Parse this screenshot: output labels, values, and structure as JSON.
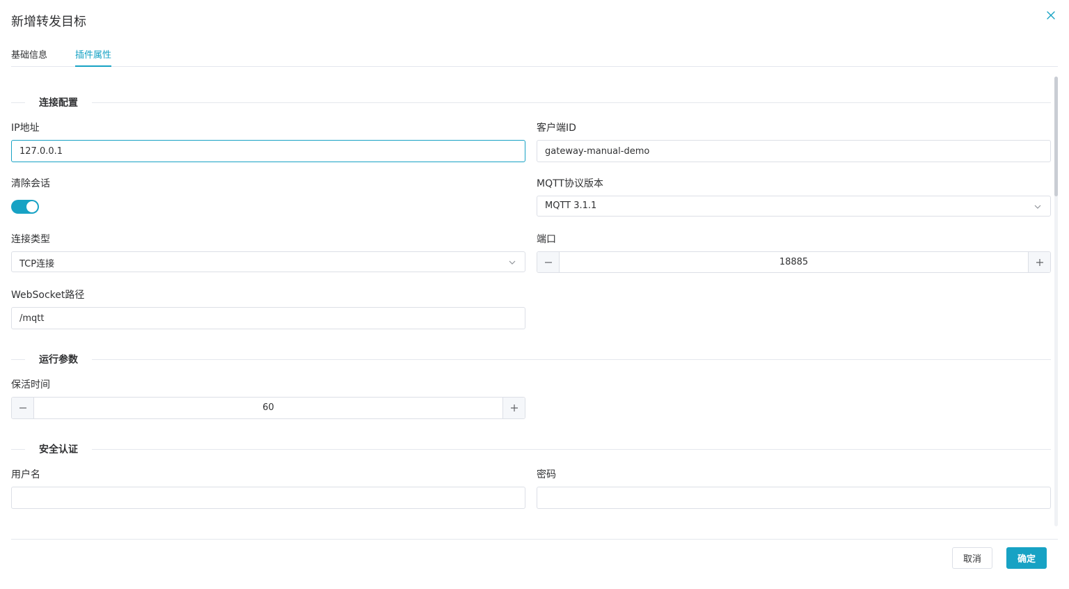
{
  "dialog": {
    "title": "新增转发目标"
  },
  "tabs": [
    {
      "label": "基础信息",
      "active": false
    },
    {
      "label": "插件属性",
      "active": true
    }
  ],
  "sections": {
    "connection": "连接配置",
    "runtime": "运行参数",
    "security": "安全认证"
  },
  "fields": {
    "ip": {
      "label": "IP地址",
      "value": "127.0.0.1"
    },
    "client_id": {
      "label": "客户端ID",
      "value": "gateway-manual-demo"
    },
    "clean_session": {
      "label": "清除会话",
      "on": true
    },
    "mqtt_version": {
      "label": "MQTT协议版本",
      "value": "MQTT 3.1.1"
    },
    "conn_type": {
      "label": "连接类型",
      "value": "TCP连接"
    },
    "port": {
      "label": "端口",
      "value": "18885"
    },
    "ws_path": {
      "label": "WebSocket路径",
      "value": "/mqtt"
    },
    "keepalive": {
      "label": "保活时间",
      "value": "60"
    },
    "username": {
      "label": "用户名",
      "value": ""
    },
    "password": {
      "label": "密码",
      "value": ""
    }
  },
  "footer": {
    "cancel_label": "取消",
    "ok_label": "确定"
  },
  "colors": {
    "accent": "#17a2c4",
    "border": "#dcdfe6",
    "text": "#303133"
  }
}
